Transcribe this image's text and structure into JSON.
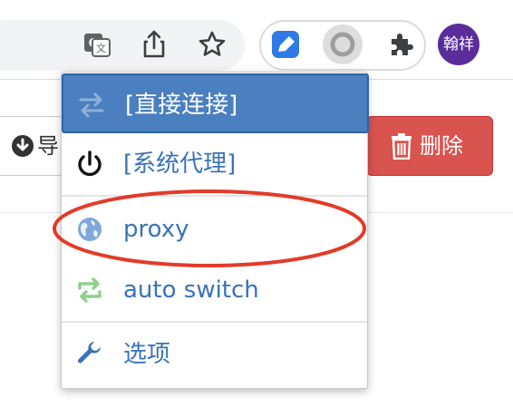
{
  "toolbar": {
    "icons": [
      "translate-icon",
      "share-icon",
      "bookmark-star-icon"
    ],
    "extensions": [
      "proxy-switchyomega-icon",
      "record-icon",
      "puzzle-icon"
    ],
    "avatar_text": "翰祥"
  },
  "page": {
    "import_label": "导",
    "delete_label": "删除"
  },
  "menu": {
    "items": [
      {
        "label": "[直接连接]",
        "icon": "arrows-swap-icon",
        "active": true
      },
      {
        "label": "[系统代理]",
        "icon": "power-icon"
      },
      {
        "label": "proxy",
        "icon": "globe-icon"
      },
      {
        "label": "auto switch",
        "icon": "auto-switch-icon"
      },
      {
        "label": "选项",
        "icon": "wrench-icon"
      }
    ]
  },
  "colors": {
    "accent_blue": "#4a7fc0",
    "link_blue": "#3973b8",
    "danger_red": "#d9534f",
    "annotation_red": "#e23b2a",
    "avatar_purple": "#5b2d9b",
    "auto_switch_green": "#8fd08a"
  }
}
